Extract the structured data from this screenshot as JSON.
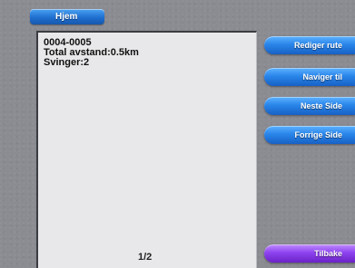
{
  "header": {
    "title": "Hjem"
  },
  "route_info": {
    "name": "0004-0005",
    "distance": "Total avstand:0.5km",
    "turns": "Svinger:2"
  },
  "pagination": {
    "indicator": "1/2"
  },
  "menu": {
    "edit_route": "Rediger rute",
    "navigate_to": "Naviger til",
    "next_page": "Neste Side",
    "previous_page": "Forrige Side",
    "back": "Tilbake"
  },
  "colors": {
    "button_blue": "#2a86ea",
    "button_purple": "#8e43f0",
    "background": "#8b8b92",
    "panel": "#e8e8ea"
  }
}
